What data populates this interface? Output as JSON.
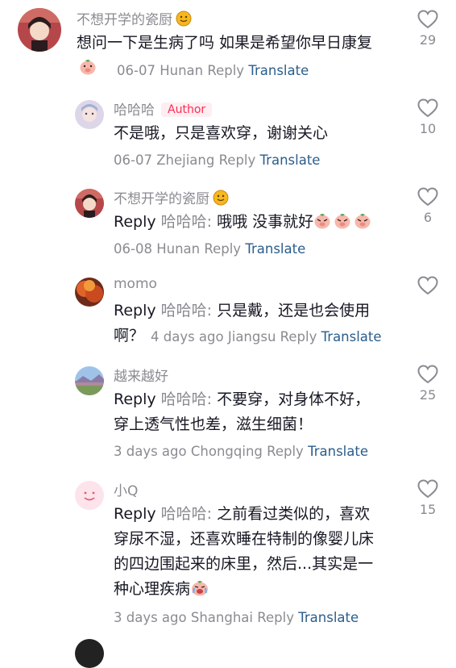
{
  "comments": [
    {
      "username": "不想开学的瓷厨",
      "text": "想问一下是生病了吗 如果是希望你早日康复",
      "date": "06-07",
      "location": "Hunan",
      "reply_label": "Reply",
      "translate_label": "Translate",
      "likes": "29",
      "icons": [
        "smiling-face-icon",
        "heart-outline-icon",
        "pig-face-emoji-icon"
      ]
    },
    {
      "username": "哈哈哈",
      "author_badge": "Author",
      "text": "不是哦，只是喜欢穿，谢谢关心",
      "date": "06-07",
      "location": "Zhejiang",
      "reply_label": "Reply",
      "translate_label": "Translate",
      "likes": "10",
      "icons": [
        "heart-outline-icon"
      ]
    },
    {
      "username": "不想开学的瓷厨",
      "reply_prefix": "Reply",
      "reply_to": "哈哈哈:",
      "text": "哦哦 没事就好",
      "date": "06-08",
      "location": "Hunan",
      "reply_label": "Reply",
      "translate_label": "Translate",
      "likes": "6",
      "icons": [
        "smiling-face-icon",
        "pig-face-emoji-icon",
        "heart-outline-icon"
      ]
    },
    {
      "username": "momo",
      "reply_prefix": "Reply",
      "reply_to": "哈哈哈:",
      "text_line1": "只是戴，还是也会使用",
      "text_line2": "啊？",
      "date": "4 days ago",
      "location": "Jiangsu",
      "reply_label": "Reply",
      "translate_label": "Translate",
      "likes": "",
      "icons": [
        "heart-outline-icon"
      ]
    },
    {
      "username": "越来越好",
      "reply_prefix": "Reply",
      "reply_to": "哈哈哈:",
      "text_line1": "不要穿，对身体不好，",
      "text_line2": "穿上透气性也差，滋生细菌！",
      "date": "3 days ago",
      "location": "Chongqing",
      "reply_label": "Reply",
      "translate_label": "Translate",
      "likes": "25",
      "icons": [
        "heart-outline-icon"
      ]
    },
    {
      "username": "小Q",
      "reply_prefix": "Reply",
      "reply_to": "哈哈哈:",
      "text_line1": "之前看过类似的，喜欢",
      "text_line2": "穿尿不湿，还喜欢睡在特制的像婴儿床",
      "text_line3": "的四边围起来的床里，然后...其实是一",
      "text_line4": "种心理疾病",
      "date": "3 days ago",
      "location": "Shanghai",
      "reply_label": "Reply",
      "translate_label": "Translate",
      "likes": "15",
      "icons": [
        "smiley-avatar-icon",
        "crying-pig-emoji-icon",
        "heart-outline-icon"
      ]
    }
  ]
}
